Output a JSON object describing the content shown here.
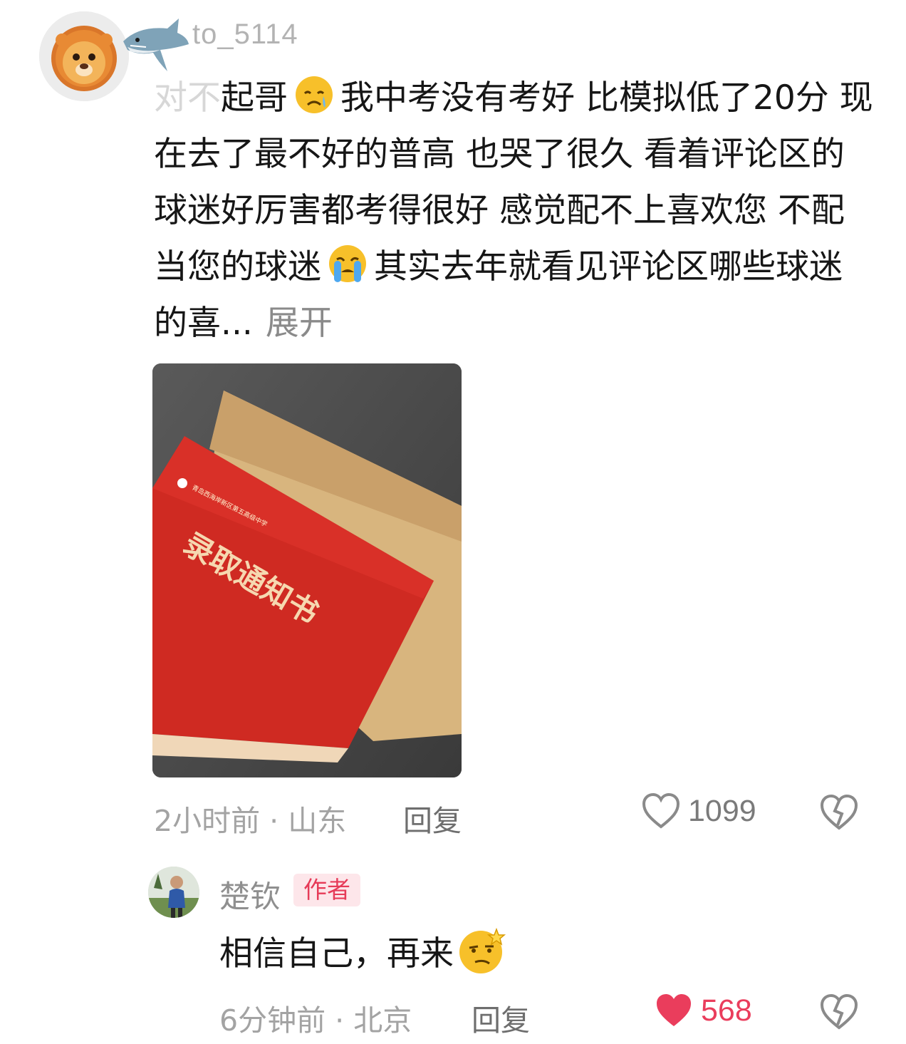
{
  "comment": {
    "username": "to_5114",
    "text_faded": "对不",
    "text_parts": [
      "起哥",
      "我中考没有考好 比模拟低了20分 现在去了最不好的普高 也哭了很久 看着评论区的球迷好厉害都考得很好 感觉配不上喜欢您 不配当您的球迷",
      "其实去年就看见评论区哪些球迷的喜..."
    ],
    "expand_label": "展开",
    "emojis": [
      "crying-face-emoji",
      "loudly-crying-face-emoji"
    ],
    "image_text": {
      "school_name": "青岛西海岸新区第五高级中学",
      "letter_title": "录取通知书"
    },
    "time": "2小时前",
    "separator": "·",
    "location": "山东",
    "reply_label": "回复",
    "likes": "1099"
  },
  "reply": {
    "username": "楚钦",
    "author_badge": "作者",
    "text": "相信自己，再来",
    "emoji": "smirk-face-emoji",
    "time": "6分钟前",
    "separator": "·",
    "location": "北京",
    "reply_label": "回复",
    "likes": "568",
    "liked": true
  },
  "colors": {
    "like_active": "#ea3d5c",
    "text_primary": "#161616",
    "text_meta": "#a3a3a3"
  }
}
